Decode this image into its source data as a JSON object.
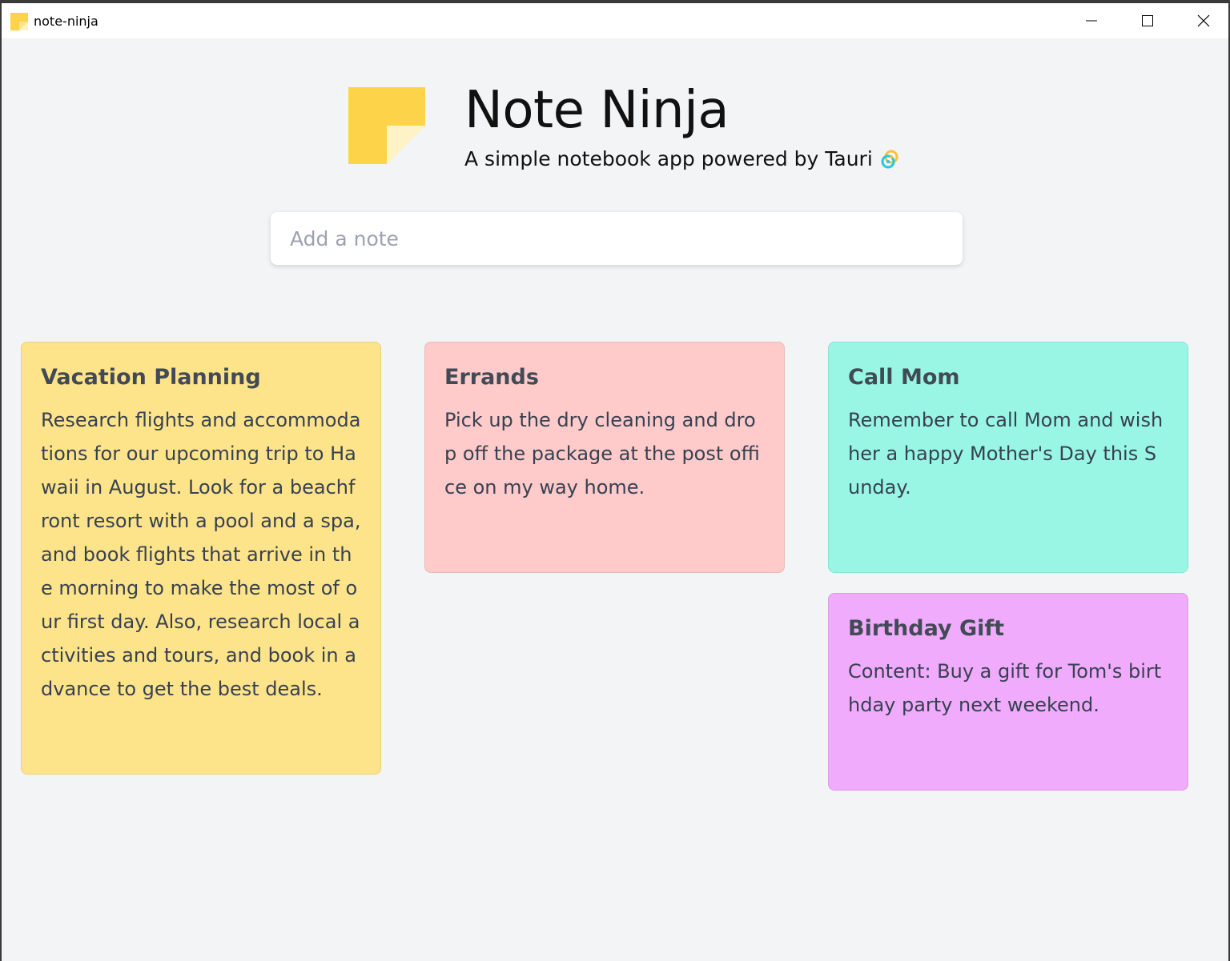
{
  "window": {
    "title": "note-ninja"
  },
  "header": {
    "app_name": "Note Ninja",
    "subtitle": "A simple notebook app powered by Tauri",
    "logo_icon": "sticky-note-icon",
    "tauri_icon": "tauri-logo-icon"
  },
  "input": {
    "placeholder": "Add a note",
    "value": ""
  },
  "notes": [
    {
      "title": "Vacation Planning",
      "content": "Research flights and accommodations for our upcoming trip to Hawaii in August. Look for a beachfront resort with a pool and a spa, and book flights that arrive in the morning to make the most of our first day. Also, research local activities and tours, and book in advance to get the best deals.",
      "color": "#fde38a"
    },
    {
      "title": "Errands",
      "content": "Pick up the dry cleaning and drop off the package at the post office on my way home.",
      "color": "#fecaca"
    },
    {
      "title": "Call Mom",
      "content": "Remember to call Mom and wish her a happy Mother's Day this Sunday.",
      "color": "#99f6e4"
    },
    {
      "title": "Birthday Gift",
      "content": "Content: Buy a gift for Tom's birthday party next weekend.",
      "color": "#f0abfc"
    }
  ],
  "colors": {
    "logo_yellow": "#fdd34a",
    "background": "#f3f4f6"
  }
}
